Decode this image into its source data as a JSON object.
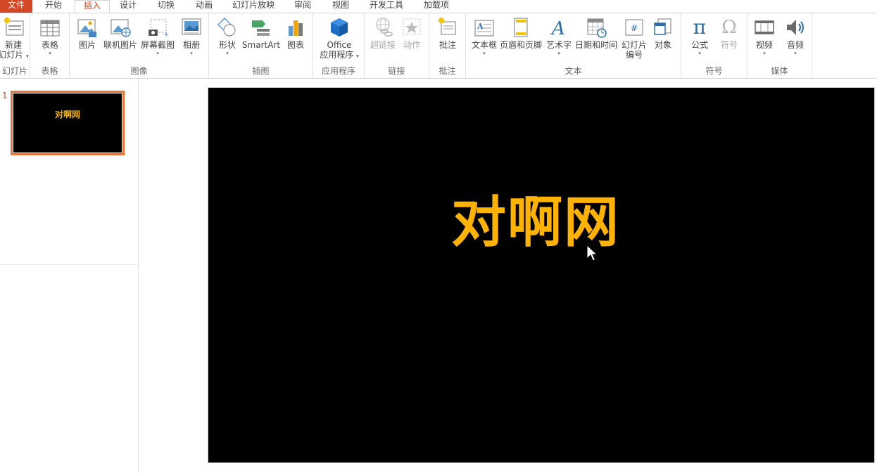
{
  "tabs": [
    "文件",
    "开始",
    "插入",
    "设计",
    "切换",
    "动画",
    "幻灯片放映",
    "审阅",
    "视图",
    "开发工具",
    "加载项"
  ],
  "active_tab": "插入",
  "groups": {
    "slides": {
      "label": "幻灯片",
      "new_slide_line1": "新建",
      "new_slide_line2": "幻灯片"
    },
    "tables": {
      "label": "表格",
      "table": "表格"
    },
    "images": {
      "label": "图像",
      "picture": "图片",
      "online_picture": "联机图片",
      "screenshot": "屏幕截图",
      "album": "相册"
    },
    "illustrations": {
      "label": "插图",
      "shapes": "形状",
      "smartart": "SmartArt",
      "chart": "图表"
    },
    "apps": {
      "label": "应用程序",
      "office_line1": "Office",
      "office_line2": "应用程序"
    },
    "links": {
      "label": "链接",
      "hyperlink": "超链接",
      "action": "动作"
    },
    "comments": {
      "label": "批注",
      "comment": "批注"
    },
    "text": {
      "label": "文本",
      "textbox": "文本框",
      "header_footer": "页眉和页脚",
      "wordart": "艺术字",
      "datetime": "日期和时间",
      "slide_number_line1": "幻灯片",
      "slide_number_line2": "编号",
      "object": "对象"
    },
    "symbols": {
      "label": "符号",
      "equation": "公式",
      "symbol": "符号",
      "pi_glyph": "π",
      "omega_glyph": "Ω"
    },
    "media": {
      "label": "媒体",
      "video": "视频",
      "audio": "音频"
    }
  },
  "thumbnails": [
    {
      "number": "1",
      "title": "对啊网"
    }
  ],
  "slide": {
    "title": "对啊网",
    "background": "#000000",
    "title_color": "#ffb300"
  },
  "colors": {
    "accent": "#d24726",
    "selection": "#e8743b"
  }
}
